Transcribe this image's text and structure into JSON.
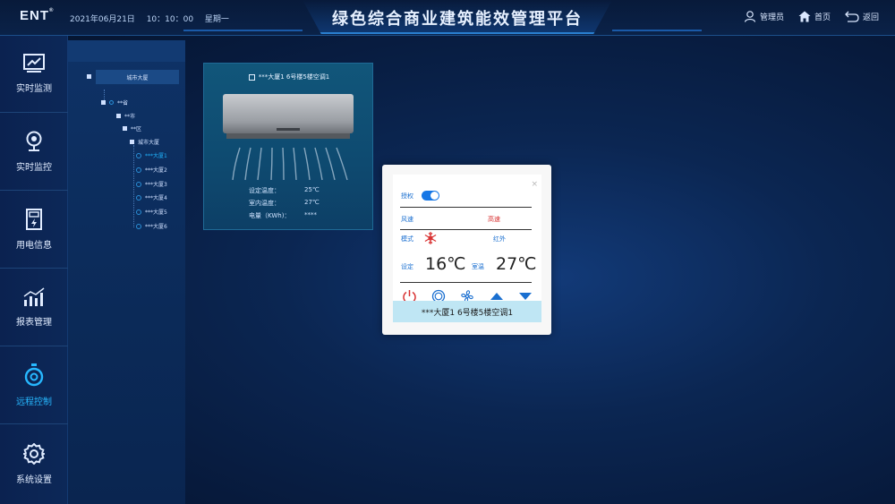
{
  "header": {
    "logo": "ENT",
    "date": "2021年06月21日",
    "time": "10：10：00",
    "weekday": "星期一",
    "title": "绿色综合商业建筑能效管理平台",
    "admin_label": "管理员",
    "home_label": "首页",
    "back_label": "返回"
  },
  "sidebar": {
    "items": [
      {
        "label": "实时监测",
        "icon": "chart-monitor-icon"
      },
      {
        "label": "实时监控",
        "icon": "camera-icon"
      },
      {
        "label": "用电信息",
        "icon": "electric-meter-icon"
      },
      {
        "label": "报表管理",
        "icon": "bar-chart-icon"
      },
      {
        "label": "远程控制",
        "icon": "stopwatch-icon",
        "active": true
      },
      {
        "label": "系统设置",
        "icon": "gear-icon"
      }
    ]
  },
  "tree": {
    "root": "城市大厦",
    "province": "**省",
    "city": "**市",
    "district": "**区",
    "building": "城市大厦",
    "towers": [
      "***大厦1",
      "***大厦2",
      "***大厦3",
      "***大厦4",
      "***大厦5",
      "***大厦6"
    ]
  },
  "card": {
    "title": "***大厦1 6号楼5楼空调1",
    "set_temp_label": "设定温度：",
    "set_temp_value": "25℃",
    "room_temp_label": "室内温度：",
    "room_temp_value": "27℃",
    "power_label": "电量（KWh)：",
    "power_value": "****"
  },
  "dialog": {
    "auth_label": "授权",
    "close": "×",
    "fan_label": "风速",
    "fan_value": "高速",
    "mode_label": "模式",
    "mode_value": "红外",
    "set_label": "设定",
    "set_temp": "16℃",
    "room_label": "室温",
    "room_temp": "27℃",
    "footer": "***大厦1 6号楼5楼空调1"
  },
  "colors": {
    "accent": "#1fb5ff",
    "red": "#d83030",
    "blue": "#1a6fd0",
    "background": "#0b2652"
  }
}
